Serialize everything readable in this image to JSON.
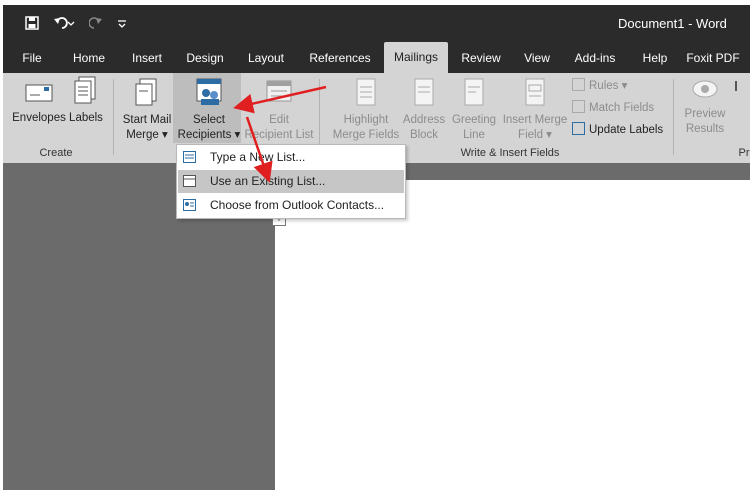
{
  "window": {
    "title": "Document1  -  Word"
  },
  "quick_access": {
    "icons": [
      "save-icon",
      "undo-icon",
      "redo-icon",
      "customize-icon"
    ]
  },
  "tabs": [
    "File",
    "Home",
    "Insert",
    "Design",
    "Layout",
    "References",
    "Mailings",
    "Review",
    "View",
    "Add-ins",
    "Help",
    "Foxit PDF"
  ],
  "active_tab": "Mailings",
  "ribbon": {
    "create": {
      "group_label": "Create",
      "envelopes": "Envelopes",
      "labels": "Labels"
    },
    "start": {
      "start_mail_line1": "Start Mail",
      "start_mail_line2": "Merge ▾",
      "select_line1": "Select",
      "select_line2": "Recipients ▾",
      "edit_line1": "Edit",
      "edit_line2": "Recipient List"
    },
    "write": {
      "group_label": "Write & Insert Fields",
      "highlight_line1": "Highlight",
      "highlight_line2": "Merge Fields",
      "address_line1": "Address",
      "address_line2": "Block",
      "greeting_line1": "Greeting",
      "greeting_line2": "Line",
      "insert_line1": "Insert Merge",
      "insert_line2": "Field ▾",
      "rules": "Rules ▾",
      "match_fields": "Match Fields",
      "update_labels": "Update Labels"
    },
    "preview": {
      "line1": "Preview",
      "line2": "Results",
      "group_label": "Pr"
    }
  },
  "dropdown": {
    "items": [
      {
        "label": "Type a New List...",
        "icon": "new-list-icon",
        "highlighted": false
      },
      {
        "label": "Use an Existing List...",
        "icon": "existing-list-icon",
        "highlighted": true
      },
      {
        "label": "Choose from Outlook Contacts...",
        "icon": "outlook-contacts-icon",
        "highlighted": false
      }
    ]
  },
  "colors": {
    "titlebar": "#2b2b2b",
    "ribbon": "#d4d4d4",
    "workspace": "#6b6b6b",
    "annotation_arrow": "#e02020"
  }
}
